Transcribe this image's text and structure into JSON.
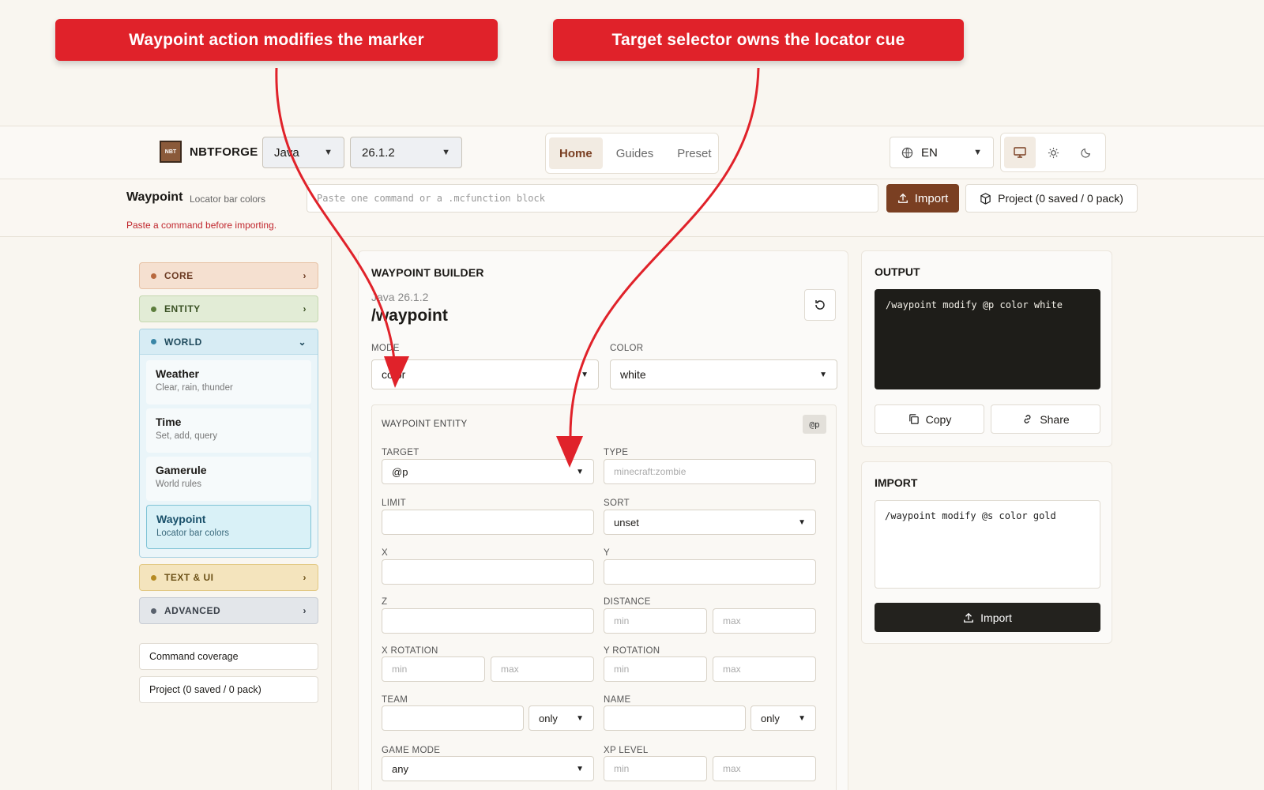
{
  "callouts": [
    "Waypoint action modifies the marker",
    "Target selector owns the locator cue"
  ],
  "colors": {
    "callout": "#e0222a",
    "accent": "#7a3f22",
    "error": "#c0262d"
  },
  "header": {
    "logo_badge": "NBT",
    "brand": "NBTFORGE",
    "edition": "Java",
    "version": "26.1.2",
    "tabs": [
      "Home",
      "Guides",
      "Preset"
    ],
    "active_tab": "Home",
    "language": "EN",
    "theme_icons": [
      "monitor-icon",
      "sun-icon",
      "moon-icon"
    ]
  },
  "command_bar": {
    "title": "Waypoint",
    "subtitle": "Locator bar colors",
    "error": "Paste a command before importing.",
    "paste_placeholder": "Paste one command or a .mcfunction block",
    "import_label": "Import",
    "project_label": "Project (0 saved / 0 pack)"
  },
  "sidebar": {
    "categories": {
      "core": "CORE",
      "entity": "ENTITY",
      "world": "WORLD",
      "text": "TEXT & UI",
      "advanced": "ADVANCED"
    },
    "world_items": [
      {
        "title": "Weather",
        "sub": "Clear, rain, thunder"
      },
      {
        "title": "Time",
        "sub": "Set, add, query"
      },
      {
        "title": "Gamerule",
        "sub": "World rules"
      },
      {
        "title": "Waypoint",
        "sub": "Locator bar colors"
      }
    ],
    "coverage": "Command coverage",
    "project": "Project (0 saved / 0 pack)"
  },
  "builder": {
    "title": "WAYPOINT BUILDER",
    "version": "Java 26.1.2",
    "command": "/waypoint",
    "mode_label": "MODE",
    "mode_value": "color",
    "color_label": "COLOR",
    "color_value": "white",
    "entity": {
      "title": "WAYPOINT ENTITY",
      "badge": "@p",
      "target_label": "TARGET",
      "target_value": "@p",
      "type_label": "TYPE",
      "type_placeholder": "minecraft:zombie",
      "limit_label": "LIMIT",
      "sort_label": "SORT",
      "sort_value": "unset",
      "x_label": "X",
      "y_label": "Y",
      "z_label": "Z",
      "distance_label": "DISTANCE",
      "xrot_label": "X ROTATION",
      "yrot_label": "Y ROTATION",
      "team_label": "TEAM",
      "name_label": "NAME",
      "only": "only",
      "gamemode_label": "GAME MODE",
      "gamemode_value": "any",
      "xp_label": "XP LEVEL",
      "min": "min",
      "max": "max"
    }
  },
  "output": {
    "title": "OUTPUT",
    "code": "/waypoint modify @p color white",
    "copy": "Copy",
    "share": "Share"
  },
  "import": {
    "title": "IMPORT",
    "code": "/waypoint modify @s color gold",
    "button": "Import"
  }
}
